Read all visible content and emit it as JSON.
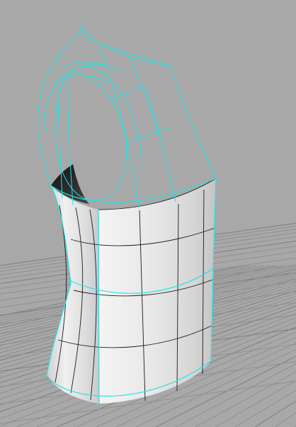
{
  "viewport": {
    "view": "perspective",
    "background_color": "#a8a8a8",
    "grid_color": "#909090",
    "selection_color": "#22e3e7",
    "surface_color": "#e2e2e2",
    "interior_color": "#2a2a2a"
  },
  "model": {
    "description_icon": "rendered-3d-surface-torso",
    "selected": true
  }
}
